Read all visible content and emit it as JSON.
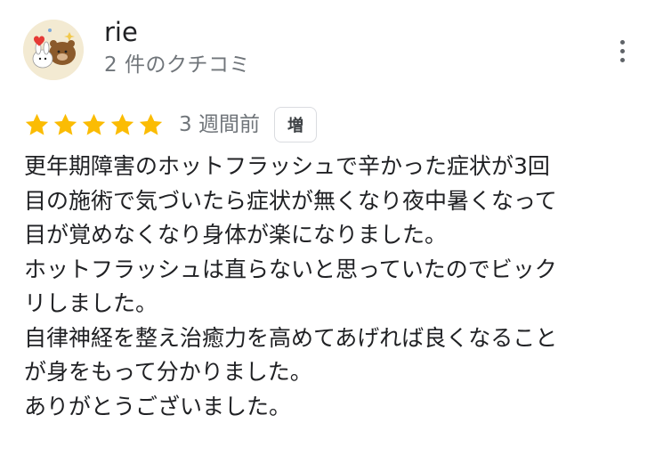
{
  "author": {
    "name": "rie",
    "review_count_label": "2 件のクチコミ"
  },
  "review": {
    "rating": 5,
    "max_rating": 5,
    "date": "3 週間前",
    "tag": "増",
    "text_lines": [
      "更年期障害のホットフラッシュで辛かった症状が3回",
      "目の施術で気づいたら症状が無くなり夜中暑くなって",
      "目が覚めなくなり身体が楽になりました。",
      "ホットフラッシュは直らないと思っていたのでビック",
      "リしました。",
      "自律神経を整え治癒力を高めてあげれば良くなること",
      "が身をもって分かりました。",
      "ありがとうございました。"
    ]
  },
  "icons": {
    "avatar": "avatar-illustration-icon",
    "more": "more-vert-icon",
    "star": "star-icon"
  },
  "colors": {
    "star": "#fbbc04",
    "meta_text": "#70757a",
    "body_text": "#202124",
    "badge_border": "#dadce0"
  }
}
